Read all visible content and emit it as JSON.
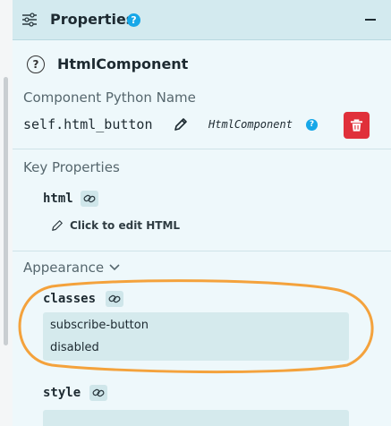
{
  "header": {
    "title": "Properties",
    "help_icon": "?",
    "collapse_icon": "minus-icon"
  },
  "component": {
    "help_icon": "?",
    "title": "HtmlComponent",
    "python_name_label": "Component Python Name",
    "python_name": "self.html_button",
    "type_name": "HtmlComponent",
    "type_help_icon": "?"
  },
  "key_properties": {
    "section_label": "Key Properties",
    "html_prop_name": "html",
    "edit_html_label": "Click to edit HTML"
  },
  "appearance": {
    "section_label": "Appearance",
    "classes_prop_name": "classes",
    "classes_values": [
      "subscribe-button",
      "disabled"
    ],
    "style_prop_name": "style",
    "style_value": ""
  },
  "colors": {
    "accent": "#16a7e8",
    "danger": "#e0303a",
    "highlight": "#f4a23c",
    "panel_bg": "#eef8fb",
    "header_bg": "#d3eaef"
  }
}
